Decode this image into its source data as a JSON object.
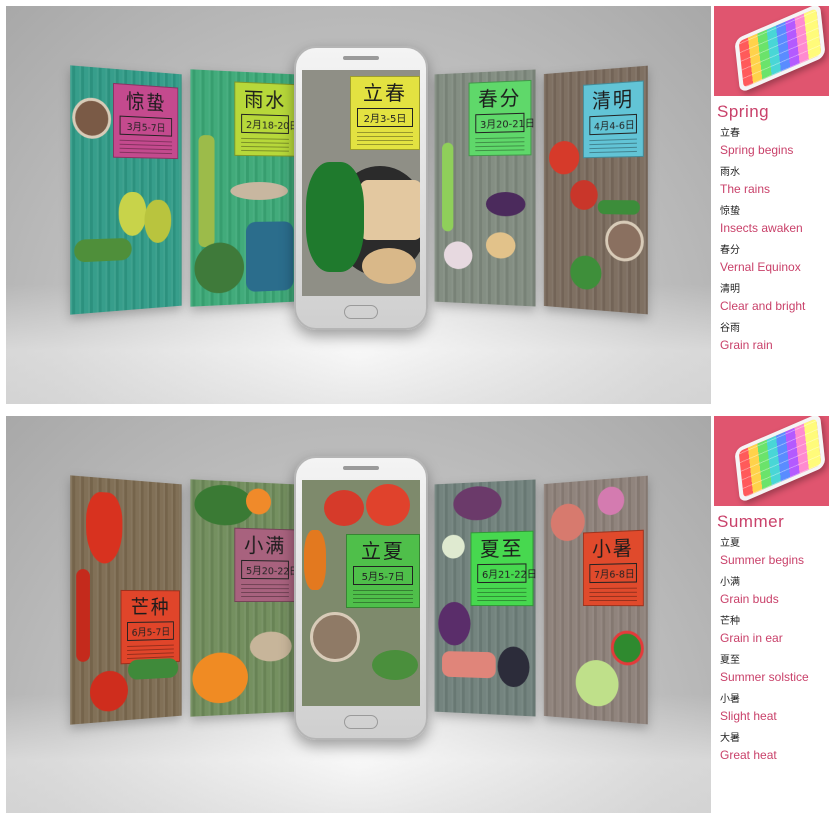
{
  "spring": {
    "heading": "Spring",
    "terms": [
      {
        "cn": "立春",
        "en": "Spring begins"
      },
      {
        "cn": "雨水",
        "en": "The rains"
      },
      {
        "cn": "惊蛰",
        "en": "Insects awaken"
      },
      {
        "cn": "春分",
        "en": "Vernal Equinox"
      },
      {
        "cn": "清明",
        "en": "Clear and bright"
      },
      {
        "cn": "谷雨",
        "en": "Grain rain"
      }
    ],
    "cards": [
      {
        "name": "惊蛰",
        "dates": "3月5-7日"
      },
      {
        "name": "雨水",
        "dates": "2月18-20日"
      },
      {
        "name": "立春",
        "dates": "2月3-5日"
      },
      {
        "name": "春分",
        "dates": "3月20-21日"
      },
      {
        "name": "清明",
        "dates": "4月4-6日"
      }
    ]
  },
  "summer": {
    "heading": "Summer",
    "terms": [
      {
        "cn": "立夏",
        "en": "Summer begins"
      },
      {
        "cn": "小满",
        "en": "Grain buds"
      },
      {
        "cn": "芒种",
        "en": "Grain in ear"
      },
      {
        "cn": "夏至",
        "en": "Summer solstice"
      },
      {
        "cn": "小暑",
        "en": "Slight heat"
      },
      {
        "cn": "大暑",
        "en": "Great heat"
      }
    ],
    "cards": [
      {
        "name": "芒种",
        "dates": "6月5-7日"
      },
      {
        "name": "小满",
        "dates": "5月20-22日"
      },
      {
        "name": "立夏",
        "dates": "5月5-7日"
      },
      {
        "name": "夏至",
        "dates": "6月21-22日"
      },
      {
        "name": "小暑",
        "dates": "7月6-8日"
      }
    ]
  },
  "colors": {
    "accent": "#c9416a",
    "sidebar_thumb": "#e0556f"
  }
}
